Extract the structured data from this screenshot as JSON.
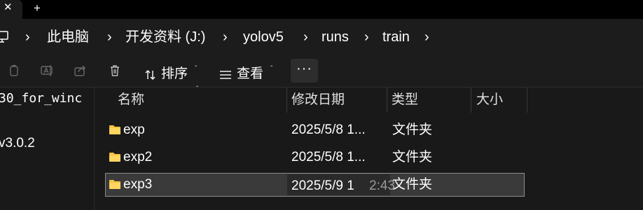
{
  "tabs": {
    "close_glyph": "✕",
    "add_glyph": "+"
  },
  "breadcrumb": {
    "items": [
      "此电脑",
      "开发资料 (J:)",
      "yolov5",
      "runs",
      "train"
    ],
    "separator": "›"
  },
  "toolbar": {
    "sort_label": "排序",
    "view_label": "查看",
    "more_label": "···"
  },
  "nav_pane": {
    "items": [
      "30_for_winc",
      "v3.0.2"
    ]
  },
  "columns": {
    "name": "名称",
    "date": "修改日期",
    "type": "类型",
    "size": "大小"
  },
  "files": [
    {
      "name": "exp",
      "date": "2025/5/8 1...",
      "type": "文件夹"
    },
    {
      "name": "exp2",
      "date": "2025/5/8 1...",
      "type": "文件夹"
    },
    {
      "name": "exp3",
      "date": "2025/5/9 1",
      "type": "文件夹",
      "selected": true
    }
  ],
  "tooltip_tail": "2:43",
  "colors": {
    "background": "#191919",
    "folder": "#f5c242",
    "selection": "#3a3a3a"
  }
}
